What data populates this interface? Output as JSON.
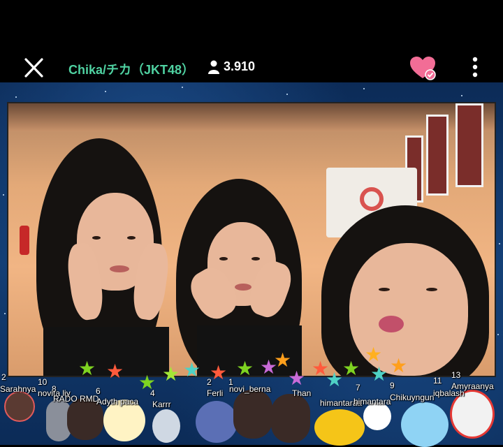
{
  "header": {
    "title": "Chika/チカ（JKT48）",
    "viewer_count": "3.910",
    "close_icon": "close-icon",
    "viewer_icon": "person-icon",
    "favorite_icon": "heart-check-icon",
    "more_icon": "more-vertical-icon",
    "title_color": "#4fd1a1",
    "heart_color": "#f26d96"
  },
  "gift_users": [
    {
      "name": "Sarahnya",
      "count": "2"
    },
    {
      "name": "novita liy",
      "count": "10"
    },
    {
      "name": "RADO RMD",
      "count": "8"
    },
    {
      "name": "Adyth paca",
      "count": "6"
    },
    {
      "name": "Karrr",
      "count": "4"
    },
    {
      "name": "Ferli",
      "count": "2"
    },
    {
      "name": "novi_berna",
      "count": "1"
    },
    {
      "name": "Than",
      "count": ""
    },
    {
      "name": "himantaraa",
      "count": "7"
    },
    {
      "name": "himantara",
      "count": ""
    },
    {
      "name": "Chikuyngun",
      "count": "9"
    },
    {
      "name": "iqbalash",
      "count": "11"
    },
    {
      "name": "Amyraanya",
      "count": "13"
    }
  ]
}
